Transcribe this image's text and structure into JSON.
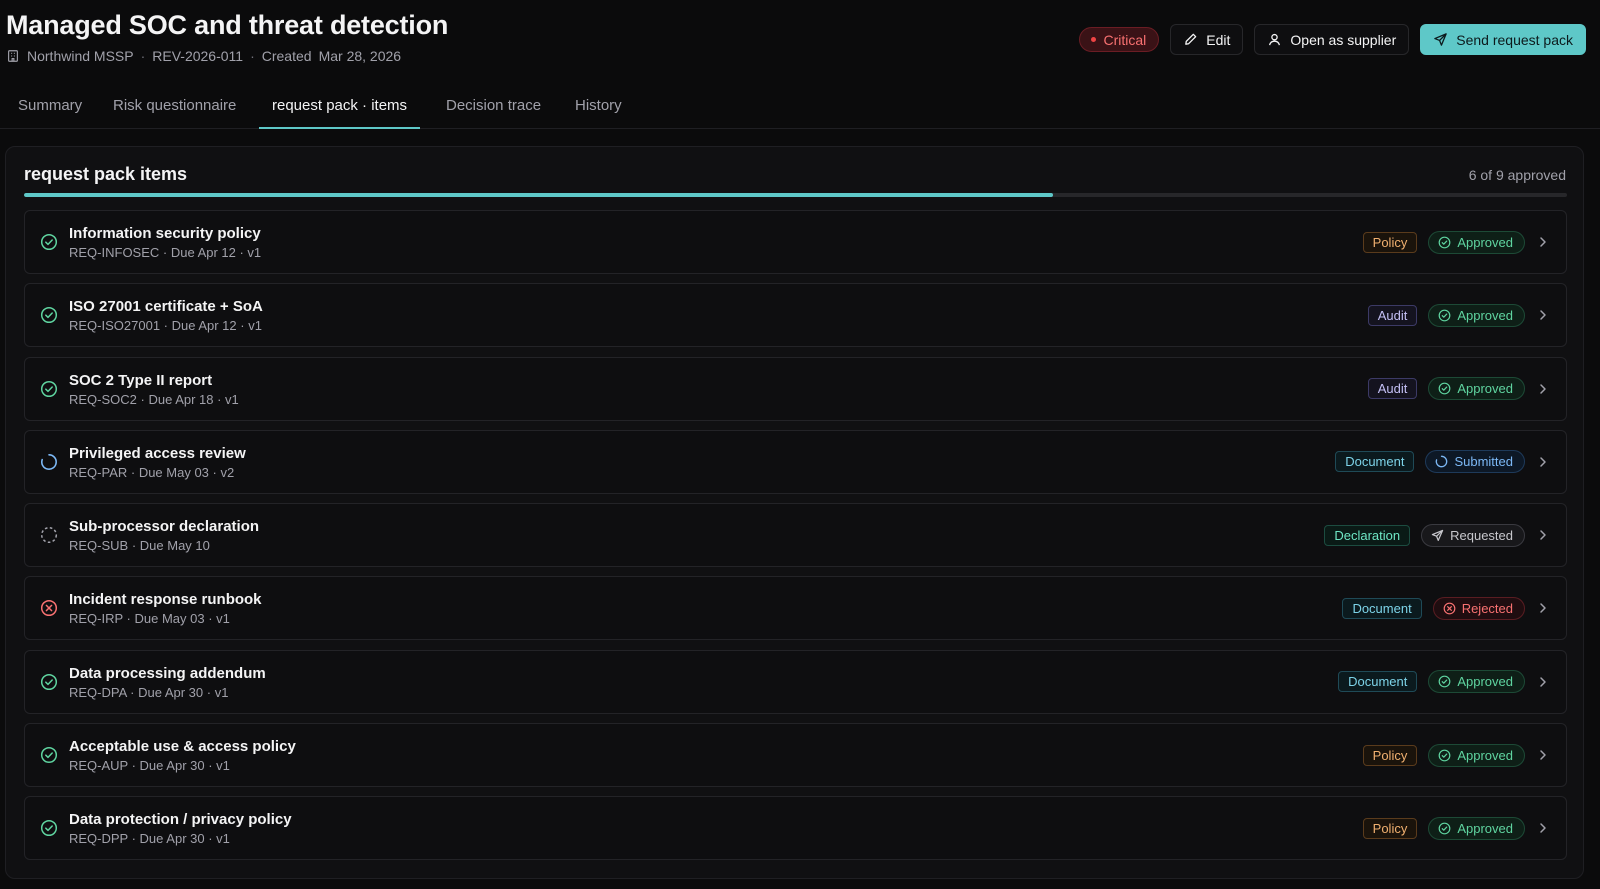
{
  "header": {
    "title": "Managed SOC and threat detection",
    "supplier": "Northwind MSSP",
    "review_id": "REV-2026-011",
    "created_label": "Created",
    "created_date": "Mar 28, 2026",
    "severity": "Critical",
    "edit_label": "Edit",
    "open_supplier_label": "Open as supplier",
    "send_label": "Send request pack"
  },
  "tabs": [
    {
      "label": "Summary"
    },
    {
      "label": "Risk questionnaire"
    },
    {
      "label": "request pack · items",
      "active": true
    },
    {
      "label": "Decision trace"
    },
    {
      "label": "History"
    }
  ],
  "panel": {
    "title": "request pack items",
    "approved_text": "6 of 9 approved",
    "approved": 6,
    "total": 9
  },
  "items": [
    {
      "title": "Information security policy",
      "sub": "REQ-INFOSEC · Due Apr 12 · v1",
      "type": "Policy",
      "status": "Approved"
    },
    {
      "title": "ISO 27001 certificate + SoA",
      "sub": "REQ-ISO27001 · Due Apr 12 · v1",
      "type": "Audit",
      "status": "Approved"
    },
    {
      "title": "SOC 2 Type II report",
      "sub": "REQ-SOC2 · Due Apr 18 · v1",
      "type": "Audit",
      "status": "Approved"
    },
    {
      "title": "Privileged access review",
      "sub": "REQ-PAR · Due May 03 · v2",
      "type": "Document",
      "status": "Submitted"
    },
    {
      "title": "Sub-processor declaration",
      "sub": "REQ-SUB · Due May 10",
      "type": "Declaration",
      "status": "Requested"
    },
    {
      "title": "Incident response runbook",
      "sub": "REQ-IRP · Due May 03 · v1",
      "type": "Document",
      "status": "Rejected"
    },
    {
      "title": "Data processing addendum",
      "sub": "REQ-DPA · Due Apr 30 · v1",
      "type": "Document",
      "status": "Approved"
    },
    {
      "title": "Acceptable use & access policy",
      "sub": "REQ-AUP · Due Apr 30 · v1",
      "type": "Policy",
      "status": "Approved"
    },
    {
      "title": "Data protection / privacy policy",
      "sub": "REQ-DPP · Due Apr 30 · v1",
      "type": "Policy",
      "status": "Approved"
    }
  ],
  "colors": {
    "accent": "#5ec8c8",
    "approved": "#5fd4a0",
    "submitted": "#7cb8f5",
    "requested": "#a1a1aa",
    "rejected": "#f87171"
  }
}
